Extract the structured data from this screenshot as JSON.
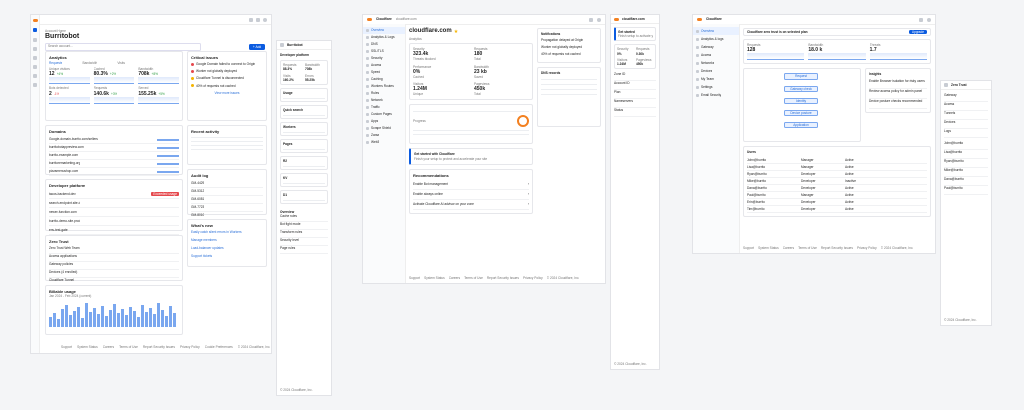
{
  "frame1": {
    "account_label": "Account Home",
    "title": "Burritobot",
    "search_placeholder": "Search account...",
    "add_label": "+ Add",
    "analytics_title": "Analytics",
    "metric_tabs": [
      "Requests",
      "Bandwidth",
      "Visits"
    ],
    "metrics": [
      {
        "label": "Unique visitors",
        "value": "12",
        "delta": "+4%"
      },
      {
        "label": "Cached",
        "value": "80.3%",
        "delta": "+2%"
      },
      {
        "label": "Bandwidth",
        "value": "708k",
        "delta": "+8%"
      },
      {
        "label": "Bots detected",
        "value": "2",
        "delta": "-1%"
      },
      {
        "label": "Requests",
        "value": "140.6k",
        "delta": "+3%"
      },
      {
        "label": "Served",
        "value": "155.25k",
        "delta": "+5%"
      }
    ],
    "domains_title": "Domains",
    "domains": [
      "Google-domain-burrito.com/sellers",
      "burritobotappreview.com",
      "burrito-example.com",
      "burritoremarketing.org",
      "pizzamenushop.com"
    ],
    "workers_title": "Developer platform",
    "workers": [
      "tacos-backend.dev",
      "search-endpoint.site.d",
      "newer-function.com",
      "burrito-demo-site.prod",
      "env-test-gate"
    ],
    "workers_badge": "Exceeded usage",
    "zero_trust_title": "Zero Trust",
    "zero_trust_items": [
      "Zero Trust Web Team",
      "Access applications",
      "Gateway policies",
      "Devices (4 enrolled)",
      "Cloudflare Tunnel"
    ],
    "billing_title": "Billable usage",
    "billing_period": "Jan 2024 - Feb 2024 (current)",
    "alerts_title": "Critical issues",
    "alerts": [
      "Google Domain failed to connect to Origin",
      "Worker not globally deployed",
      "Cloudflare Tunnel is disconnected",
      "40% of requests not cached"
    ],
    "view_more": "View more issues",
    "recent_title": "Recent activity",
    "audit_title": "Audit log",
    "audit_rows": [
      "GM-4429",
      "GM-5312",
      "GM-6081",
      "GM-7723",
      "GM-8010"
    ],
    "news_title": "What's new",
    "news": [
      "Easily catch silent errors in Workers",
      "Manage members",
      "Load-balancer updates",
      "Support tickets"
    ],
    "footer": [
      "Support",
      "System Status",
      "Careers",
      "Terms of Use",
      "Report Security Issues",
      "Privacy Policy",
      "Cookie Preferences",
      "© 2024 Cloudflare, Inc."
    ]
  },
  "frame2": {
    "sidebar_heading": "Burritobot",
    "section_title": "Developer platform",
    "cards": [
      "Usage",
      "Quick search",
      "Workers",
      "Pages",
      "R2",
      "KV",
      "D1"
    ],
    "stats": [
      {
        "label": "Requests",
        "value": "88.3%"
      },
      {
        "label": "Bandwidth",
        "value": "708k"
      },
      {
        "label": "Visits",
        "value": "160.2%"
      },
      {
        "label": "Errors",
        "value": "55.25k"
      }
    ],
    "list_title": "Overview",
    "list_items": [
      "Cache rules",
      "Bot fight mode",
      "Transform rules",
      "Security level",
      "Page rules"
    ],
    "footer": "© 2024 Cloudflare, Inc."
  },
  "frame3": {
    "logo": "Cloudflare",
    "breadcrumb": "cloudflare.com",
    "domain": "cloudflare.com",
    "sidebar_items": [
      "Overview",
      "Analytics & Logs",
      "DNS",
      "SSL/TLS",
      "Security",
      "Access",
      "Speed",
      "Caching",
      "Workers Routes",
      "Rules",
      "Network",
      "Traffic",
      "Custom Pages",
      "Apps",
      "Scrape Shield",
      "Zaraz",
      "Web3"
    ],
    "analytics_label": "Analytics",
    "metrics": [
      {
        "label": "Security",
        "value": "323.4k",
        "sub": "Threats blocked"
      },
      {
        "label": "Requests",
        "value": "180",
        "sub": "Total"
      },
      {
        "label": "Performance",
        "value": "0%",
        "sub": "Cached"
      },
      {
        "label": "Bandwidth",
        "value": "23 kb",
        "sub": "Saved"
      },
      {
        "label": "Visitors",
        "value": "1.24M",
        "sub": "Unique"
      },
      {
        "label": "Pageviews",
        "value": "450k",
        "sub": "Total"
      }
    ],
    "alert_title": "Get started with Cloudflare",
    "alert_text": "Finish your setup to protect and accelerate your site",
    "recommendations_title": "Recommendations",
    "recommendations": [
      "Enable Bot management",
      "Enable always online",
      "Activate Cloudflare AI advisor on your zone"
    ],
    "right_panel_title": "Notifications",
    "right_items": [
      "Propagation delayed at Origin",
      "Worker not globally deployed",
      "40% of requests not cached"
    ],
    "dns_title": "DNS records",
    "footer": [
      "Support",
      "System Status",
      "Careers",
      "Terms of Use",
      "Report Security Issues",
      "Privacy Policy",
      "© 2024 Cloudflare, Inc."
    ]
  },
  "frame4": {
    "title": "cloudflare.com",
    "setup_title": "Get started",
    "setup_text": "Finish setup to activate your zone",
    "stats": [
      {
        "label": "Security",
        "value": "0%"
      },
      {
        "label": "Requests",
        "value": "0.30k"
      },
      {
        "label": "Visitors",
        "value": "1.24M"
      },
      {
        "label": "Pageviews",
        "value": "450k"
      }
    ],
    "list_items": [
      "Zone ID",
      "Account ID",
      "Plan",
      "Nameservers",
      "Status"
    ],
    "footer": "© 2024 Cloudflare, Inc."
  },
  "frame5": {
    "logo": "Cloudflare",
    "banner": "Cloudflare zero trust is on selected plan",
    "banner_action": "Upgrade",
    "sidebar_items": [
      "Overview",
      "Analytics & logs",
      "Gateway",
      "Access",
      "Networks",
      "Devices",
      "My Team",
      "Settings",
      "Email Security"
    ],
    "kpis": [
      {
        "label": "Requests",
        "value": "128"
      },
      {
        "label": "Bandwidth",
        "value": "18.0 k"
      },
      {
        "label": "Threats",
        "value": "1.7"
      }
    ],
    "workflow_nodes": [
      "Request",
      "Gateway check",
      "Identity",
      "Device posture",
      "Application"
    ],
    "insights_title": "Insights",
    "insights": [
      "Enable Browser isolation for risky users",
      "Review access policy for admin panel",
      "Device posture checks recommended"
    ],
    "table_title": "Users",
    "table_rows": [
      [
        "John@burrito",
        "Manager",
        "Active"
      ],
      [
        "Lisa@burrito",
        "Manager",
        "Active"
      ],
      [
        "Ryan@burrito",
        "Developer",
        "Active"
      ],
      [
        "Mike@burrito",
        "Developer",
        "Inactive"
      ],
      [
        "Dana@burrito",
        "Developer",
        "Active"
      ],
      [
        "Paul@burrito",
        "Manager",
        "Active"
      ],
      [
        "Erin@burrito",
        "Developer",
        "Active"
      ],
      [
        "Tim@burrito",
        "Developer",
        "Active"
      ]
    ],
    "footer": [
      "Support",
      "System Status",
      "Careers",
      "Terms of Use",
      "Report Security Issues",
      "Privacy Policy",
      "© 2024 Cloudflare, Inc."
    ]
  },
  "frame6": {
    "title": "Zero Trust",
    "items": [
      "Gateway",
      "Access",
      "Tunnels",
      "Devices",
      "Logs"
    ],
    "table_rows": [
      "John@burrito",
      "Lisa@burrito",
      "Ryan@burrito",
      "Mike@burrito",
      "Dana@burrito",
      "Paul@burrito"
    ],
    "footer": "© 2024 Cloudflare, Inc."
  },
  "colors": {
    "accent": "#0b5be0",
    "brand": "#f38020",
    "danger": "#e5484d",
    "success": "#2f9e44"
  }
}
